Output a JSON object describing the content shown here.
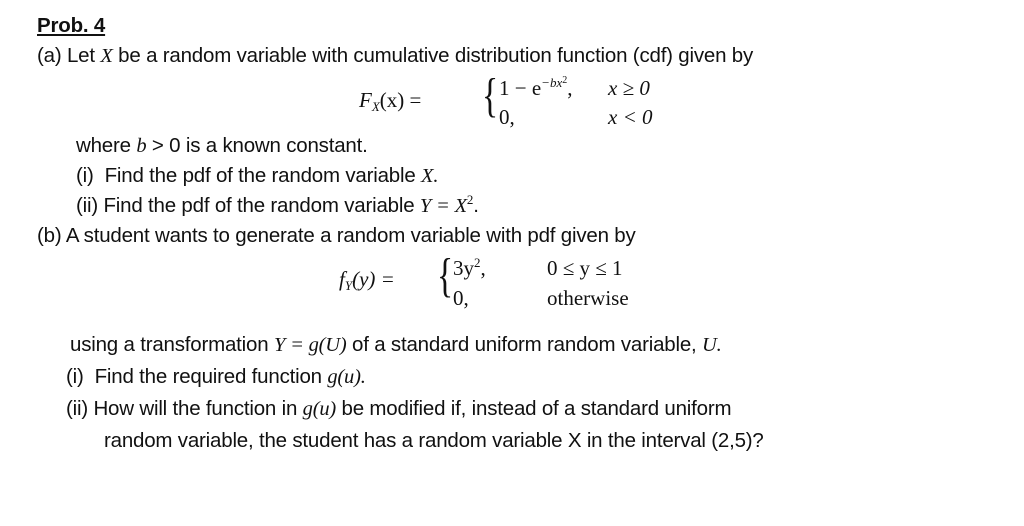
{
  "problem": {
    "title": "Prob. 4",
    "a": {
      "intro_pre": "(a) Let ",
      "intro_var": "X",
      "intro_post": " be a random variable with cumulative distribution function (cdf) given by",
      "cdf": {
        "lhs_func": "F",
        "lhs_sub": "X",
        "lhs_arg": "(x) =",
        "case1_expr": "1 − e",
        "case1_exp": "−bx",
        "case1_exp_sup": "2",
        "case1_comma": ",",
        "case1_cond": "x ≥ 0",
        "case2_expr": "0,",
        "case2_cond": "x < 0"
      },
      "where_pre": "where ",
      "where_var": "b",
      "where_post": " > 0 is a known constant.",
      "i_label": "(i)  Find the pdf of the random variable ",
      "i_var": "X.",
      "ii_label": "(ii) Find the pdf of the random variable ",
      "ii_var": "Y = X",
      "ii_sup": "2",
      "ii_end": "."
    },
    "b": {
      "intro": "(b) A student wants to generate a random variable with pdf given by",
      "pdf": {
        "lhs_func": "f",
        "lhs_sub": "Y",
        "lhs_arg": "(y) =",
        "case1_expr": "3y",
        "case1_sup": "2",
        "case1_comma": ",",
        "case1_cond": "0 ≤ y ≤ 1",
        "case2_expr": "0,",
        "case2_cond": "otherwise"
      },
      "using_pre": "using a transformation ",
      "using_eq": "Y = g(U)",
      "using_mid": " of a standard uniform random variable, ",
      "using_var": "U.",
      "i_label": "(i)  Find the required function ",
      "i_var": "g(u).",
      "ii_pre": "(ii) How will the function in ",
      "ii_var": "g(u)",
      "ii_post": " be modified if, instead of a standard uniform",
      "ii_line2": "random variable, the student has a random variable X in the interval (2,5)?"
    }
  }
}
